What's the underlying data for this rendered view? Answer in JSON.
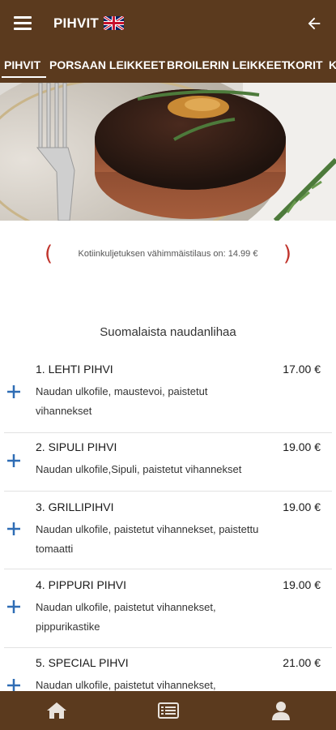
{
  "header": {
    "title": "PIHVIT",
    "menu_icon": "hamburger-menu-icon",
    "language_icon": "uk-flag-icon",
    "back_icon": "arrow-left-icon"
  },
  "tabs": [
    {
      "label": "PIHVIT",
      "active": true
    },
    {
      "label": "PORSAAN LEIKKEET",
      "active": false
    },
    {
      "label": "BROILERIN LEIKKEET",
      "active": false
    },
    {
      "label": "KORIT",
      "active": false
    },
    {
      "label": "K",
      "active": false
    }
  ],
  "notice": {
    "text": "Kotiinkuljetuksen vähimmäistilaus on: 14.99 €"
  },
  "section": {
    "title": "Suomalaista naudanlihaa"
  },
  "items": [
    {
      "name": "1. LEHTI PIHVI",
      "price": "17.00 €",
      "desc_lines": [
        "Naudan ulkofile, maustevoi, paistetut",
        "vihannekset"
      ]
    },
    {
      "name": "2. SIPULI PIHVI",
      "price": "19.00 €",
      "desc_lines": [
        "Naudan ulkofile,Sipuli, paistetut vihannekset"
      ]
    },
    {
      "name": "3. GRILLIPIHVI",
      "price": "19.00 €",
      "desc_lines": [
        "Naudan ulkofile, paistetut vihannekset, paistettu",
        "tomaatti"
      ]
    },
    {
      "name": "4. PIPPURI PIHVI",
      "price": "19.00 €",
      "desc_lines": [
        "Naudan ulkofile, paistetut vihannekset,",
        "pippurikastike"
      ]
    },
    {
      "name": "5. SPECIAL PIHVI",
      "price": "21.00 €",
      "desc_lines": [
        "Naudan ulkofile, paistetut vihannekset,"
      ]
    }
  ],
  "bottom_nav": [
    {
      "icon": "home-icon"
    },
    {
      "icon": "menu-list-icon"
    },
    {
      "icon": "user-icon"
    }
  ],
  "colors": {
    "brand": "#5b3a1e",
    "accent_plus": "#2f6db5",
    "notice_paren": "#c0342c"
  }
}
